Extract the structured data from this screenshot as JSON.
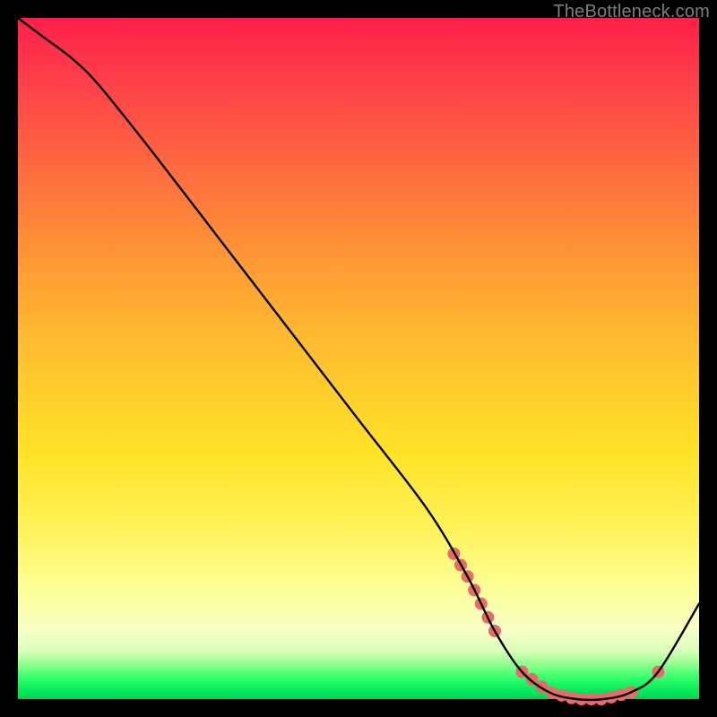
{
  "watermark": "TheBottleneck.com",
  "chart_data": {
    "type": "line",
    "title": "",
    "xlabel": "",
    "ylabel": "",
    "xlim": [
      0,
      100
    ],
    "ylim": [
      0,
      100
    ],
    "grid": false,
    "legend": false,
    "background_gradient": {
      "stops": [
        {
          "pos": 0.0,
          "color": "#ff1f4a"
        },
        {
          "pos": 0.5,
          "color": "#ffc22e"
        },
        {
          "pos": 0.84,
          "color": "#fdff99"
        },
        {
          "pos": 0.97,
          "color": "#2dff6a"
        },
        {
          "pos": 1.0,
          "color": "#00d453"
        }
      ]
    },
    "series": [
      {
        "name": "bottleneck-curve",
        "color": "#000000",
        "x": [
          0,
          4,
          8,
          12,
          20,
          30,
          40,
          50,
          60,
          66,
          70,
          74,
          78,
          82,
          86,
          90,
          94,
          100
        ],
        "y": [
          100,
          97,
          94,
          90,
          80,
          67,
          54,
          41,
          28,
          18,
          10,
          4,
          1,
          0,
          0,
          1,
          4,
          14
        ]
      }
    ],
    "markers": {
      "name": "highlight-dots",
      "color": "#e96a6a",
      "radius": 7,
      "cluster_segments": [
        {
          "x_start": 64,
          "x_end": 70,
          "count": 7
        },
        {
          "x_start": 74,
          "x_end": 90,
          "count": 12
        }
      ],
      "isolated": [
        {
          "x": 94,
          "y": 4
        }
      ]
    }
  }
}
